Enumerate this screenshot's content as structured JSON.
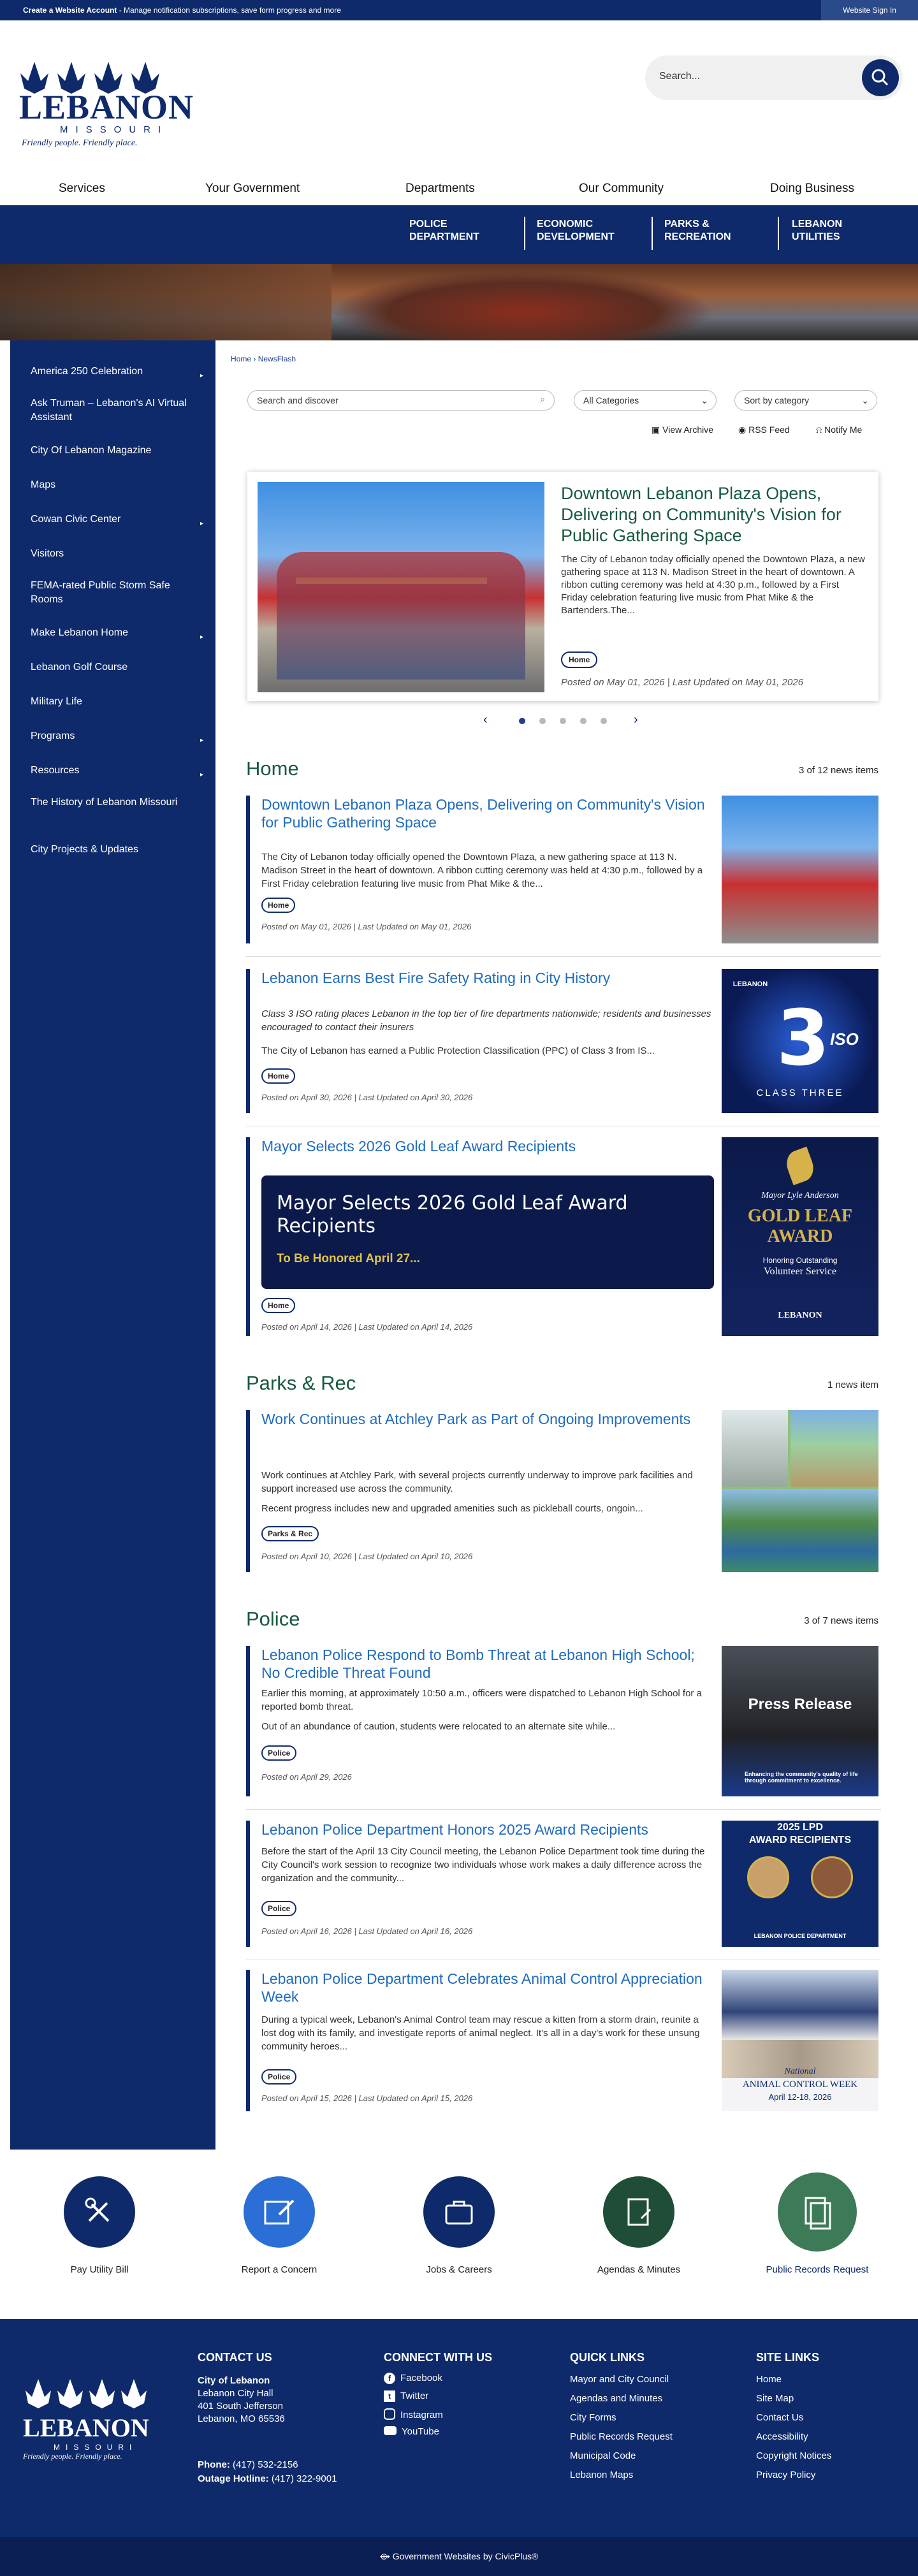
{
  "topbar": {
    "bold": "Create a Website Account",
    "msg": " - Manage notification subscriptions, save form progress and more",
    "signin": "Website Sign In"
  },
  "brand": {
    "name": "LEBANON",
    "state": "MISSOURI",
    "tagline": "Friendly people.  Friendly place.",
    "colors": {
      "navy": "#0e2a6b",
      "green": "#185a3e",
      "link": "#1f6bbd"
    }
  },
  "search": {
    "placeholder": "Search..."
  },
  "mainnav": [
    "Services",
    "Your Government",
    "Departments",
    "Our Community",
    "Doing Business"
  ],
  "subnav": [
    {
      "l1": "POLICE",
      "l2": "DEPARTMENT"
    },
    {
      "l1": "ECONOMIC",
      "l2": "DEVELOPMENT"
    },
    {
      "l1": "PARKS &",
      "l2": "RECREATION"
    },
    {
      "l1": "LEBANON",
      "l2": "UTILITIES"
    }
  ],
  "sidebar": [
    {
      "label": "America 250 Celebration",
      "chev": true
    },
    {
      "label": "Ask Truman – Lebanon's AI Virtual Assistant",
      "chev": false
    },
    {
      "label": "City Of Lebanon Magazine",
      "chev": false
    },
    {
      "label": "Maps",
      "chev": false
    },
    {
      "label": "Cowan Civic Center",
      "chev": true
    },
    {
      "label": "Visitors",
      "chev": false
    },
    {
      "label": "FEMA-rated Public Storm Safe Rooms",
      "chev": false
    },
    {
      "label": "Make Lebanon Home",
      "chev": true
    },
    {
      "label": "Lebanon Golf Course",
      "chev": false
    },
    {
      "label": "Military Life",
      "chev": false
    },
    {
      "label": "Programs",
      "chev": true
    },
    {
      "label": "Resources",
      "chev": true
    },
    {
      "label": "The History of Lebanon Missouri",
      "chev": false
    },
    {
      "label": "City Projects & Updates",
      "chev": false
    }
  ],
  "breadcrumb": {
    "home": "Home",
    "sep": " › ",
    "current": "NewsFlash"
  },
  "filters": {
    "search_placeholder": "Search and discover",
    "category": "All Categories",
    "sort": "Sort by category"
  },
  "tools": {
    "archive": "View Archive",
    "rss": "RSS Feed",
    "notify": "Notify Me"
  },
  "featured": {
    "title": "Downtown Lebanon Plaza Opens, Delivering on Community's Vision for Public Gathering Space",
    "desc": "The City of Lebanon today officially opened the Downtown Plaza, a new gathering space at 113 N. Madison Street in the heart of downtown. A ribbon cutting ceremony was held at 4:30 p.m., followed by a First Friday celebration featuring live music from Phat Mike & the Bartenders.The...",
    "tag": "Home",
    "date": "Posted on May 01, 2026 | Last Updated on May 01, 2026"
  },
  "sections": [
    {
      "title": "Home",
      "count": "3 of 12 news items",
      "items": [
        {
          "title": "Downtown Lebanon Plaza Opens, Delivering on Community's Vision for Public Gathering Space",
          "desc1": "The City of Lebanon today officially opened the Downtown Plaza, a new gathering space at 113 N. Madison Street in the heart of downtown. A ribbon cutting ceremony was held at 4:30 p.m., followed by a First Friday celebration featuring live music from Phat Mike & the...",
          "desc2": "",
          "tag": "Home",
          "date": "Posted on May 01, 2026 | Last Updated on May 01, 2026"
        },
        {
          "title": "Lebanon Earns Best Fire Safety Rating in City History",
          "desc1": "Class 3 ISO rating places Lebanon in the top tier of fire departments nationwide; residents and businesses encouraged to contact their insurers",
          "desc2": "The City of Lebanon has earned a Public Protection Classification (PPC) of Class 3 from IS...",
          "tag": "Home",
          "date": "Posted on April 30, 2026 | Last Updated on April 30, 2026"
        },
        {
          "title": "Mayor Selects 2026 Gold Leaf Award Recipients",
          "banner_title": "Mayor Selects 2026 Gold Leaf Award Recipients",
          "banner_sub": "To Be Honored April 27...",
          "tag": "Home",
          "date": "Posted on April 14, 2026 | Last Updated on April 14, 2026"
        }
      ]
    },
    {
      "title": "Parks & Rec",
      "count": "1 news item",
      "items": [
        {
          "title": "Work Continues at Atchley Park as Part of Ongoing Improvements",
          "desc1": "Work continues at Atchley Park, with several projects currently underway to improve park facilities and support increased use across the community.",
          "desc2": "Recent progress includes new and upgraded amenities such as pickleball courts, ongoin...",
          "tag": "Parks & Rec",
          "date": "Posted on April 10, 2026 | Last Updated on April 10, 2026"
        }
      ]
    },
    {
      "title": "Police",
      "count": "3 of 7 news items",
      "items": [
        {
          "title": "Lebanon Police Respond to Bomb Threat at Lebanon High School; No Credible Threat Found",
          "desc1": "Earlier this morning, at approximately 10:50 a.m., officers were dispatched to Lebanon High School for a reported bomb threat.",
          "desc2": "Out of an abundance of caution, students were relocated to an alternate site while...",
          "tag": "Police",
          "date": "Posted on April 29, 2026"
        },
        {
          "title": "Lebanon Police Department Honors 2025 Award Recipients",
          "desc1": "Before the start of the April 13 City Council meeting, the Lebanon Police Department took time during the City Council's work session to recognize two individuals whose work makes a daily difference across the organization and the community...",
          "desc2": "",
          "tag": "Police",
          "date": "Posted on April 16, 2026 | Last Updated on April 16, 2026"
        },
        {
          "title": "Lebanon Police Department Celebrates Animal Control Appreciation Week",
          "desc1": "During a typical week, Lebanon's Animal Control team may rescue a kitten from a storm drain, reunite a lost dog with its family, and investigate reports of animal neglect. It's all in a day's work for these unsung community heroes...",
          "desc2": "",
          "tag": "Police",
          "date": "Posted on April 15, 2026 | Last Updated on April 15, 2026"
        }
      ]
    }
  ],
  "thumbs": {
    "iso_number": "3",
    "iso_label": "ISO",
    "iso_class": "CLASS THREE",
    "iso_brand": "LEBANON",
    "gold_mayor": "Mayor Lyle Anderson",
    "gold_title": "GOLD LEAF",
    "gold_award": "AWARD",
    "gold_sub": "Honoring Outstanding",
    "gold_sub2": "Volunteer Service",
    "press": "Press Release",
    "press_foot": "Enhancing the community's quality of life through commitment to excellence.",
    "lpd_title1": "2025 LPD",
    "lpd_title2": "AWARD RECIPIENTS",
    "lpd_foot": "LEBANON POLICE DEPARTMENT",
    "acw_title": "ANIMAL CONTROL WEEK",
    "acw_date": "April 12-18, 2026",
    "acw_script": "National"
  },
  "quicklinks": [
    {
      "label": "Pay Utility Bill",
      "color": "#0e2a6b"
    },
    {
      "label": "Report a Concern",
      "color": "#2b6fd6"
    },
    {
      "label": "Jobs & Careers",
      "color": "#0e2a6b"
    },
    {
      "label": "Agendas & Minutes",
      "color": "#1f4d38"
    },
    {
      "label": "Public Records Request",
      "color": "#3d7a58"
    }
  ],
  "footer": {
    "contact": {
      "heading": "CONTACT US",
      "name": "City of Lebanon",
      "l1": "Lebanon City Hall",
      "l2": "401 South Jefferson",
      "l3": "Lebanon, MO 65536",
      "phone_label": "Phone:",
      "phone": " (417) 532-2156",
      "outage_label": "Outage Hotline:",
      "outage": " (417) 322-9001"
    },
    "connect": {
      "heading": "CONNECT WITH US",
      "items": [
        "Facebook",
        "Twitter",
        "Instagram",
        "YouTube"
      ]
    },
    "quick": {
      "heading": "QUICK LINKS",
      "items": [
        "Mayor and City Council",
        "Agendas and Minutes",
        "City Forms",
        "Public Records Request",
        "Municipal Code",
        "Lebanon Maps"
      ]
    },
    "site": {
      "heading": "SITE LINKS",
      "items": [
        "Home",
        "Site Map",
        "Contact Us",
        "Accessibility",
        "Copyright Notices",
        "Privacy Policy"
      ]
    }
  },
  "bottom": {
    "text": "Government Websites by CivicPlus®"
  }
}
